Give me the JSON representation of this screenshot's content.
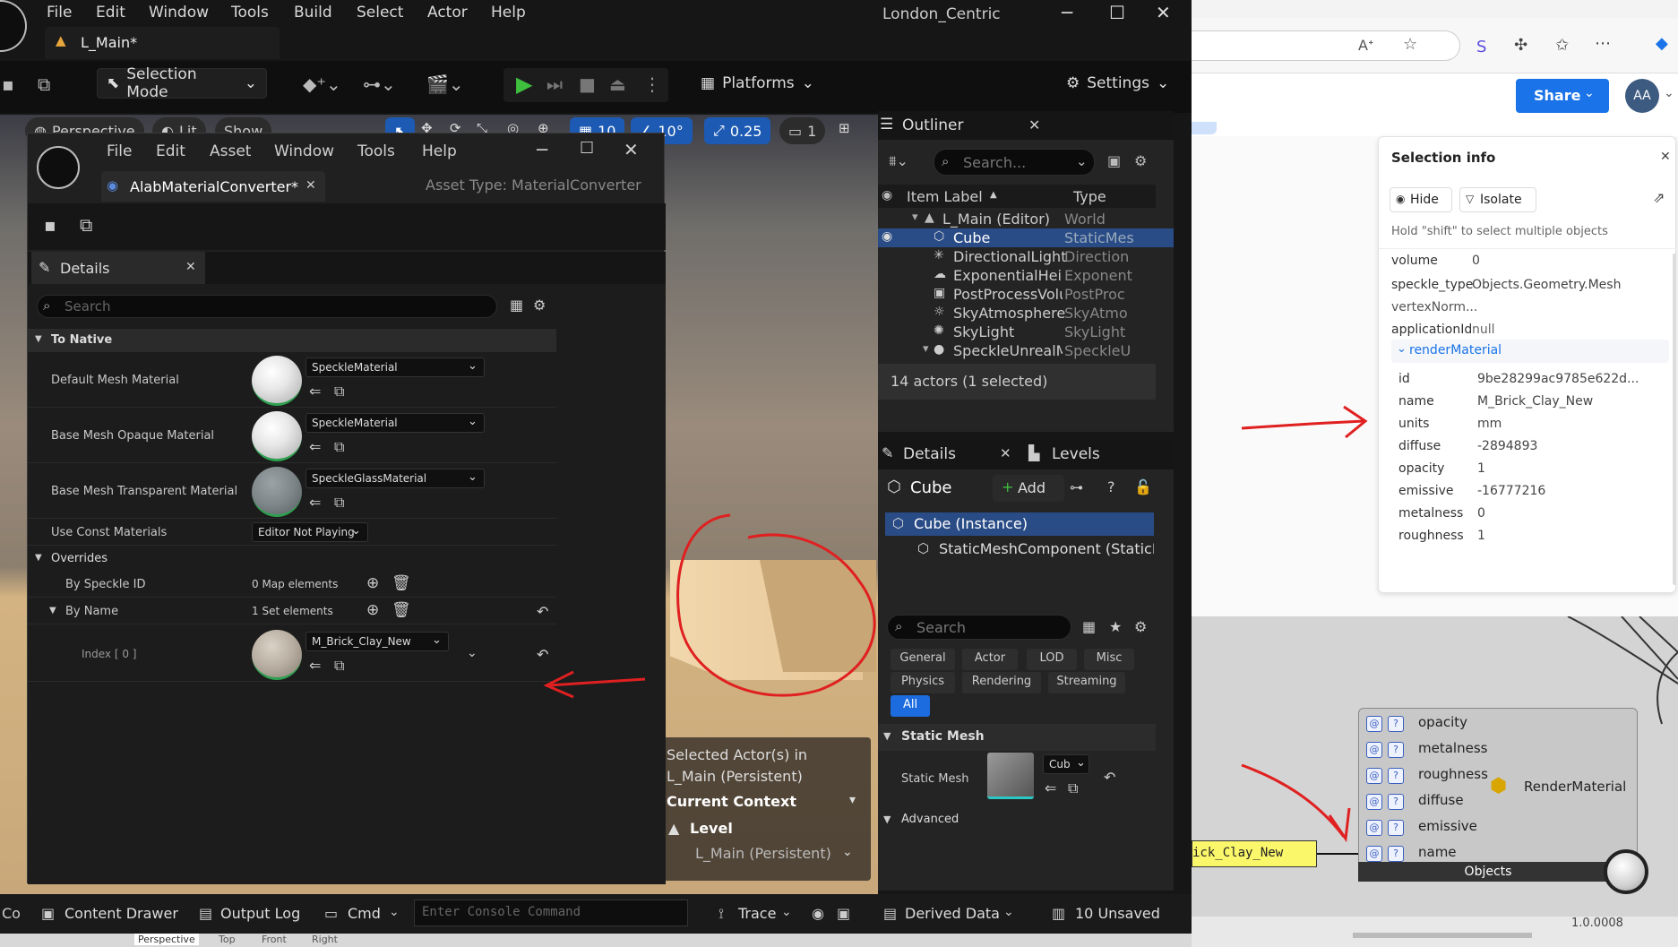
{
  "main_window": {
    "menu": [
      "File",
      "Edit",
      "Window",
      "Tools",
      "Build",
      "Select",
      "Actor",
      "Help"
    ],
    "project_title": "London_Centric",
    "tab": "L_Main*",
    "toolbar": {
      "selection_mode": "Selection Mode",
      "platforms": "Platforms",
      "settings": "Settings"
    },
    "viewport": {
      "perspective": "Perspective",
      "lit": "Lit",
      "show": "Show",
      "grid_value": "10",
      "angle_value": "10°",
      "scale_value": "0.25",
      "camera_value": "1",
      "bottom_tabs": [
        "Perspective",
        "Top",
        "Front",
        "Right"
      ]
    },
    "statusbar": {
      "content_drawer": "Content Drawer",
      "output_log": "Output Log",
      "cmd": "Cmd",
      "console_placeholder": "Enter Console Command",
      "trace": "Trace",
      "derived_data": "Derived Data",
      "unsaved": "10 Unsaved"
    }
  },
  "outliner": {
    "title": "Outliner",
    "search_placeholder": "Search...",
    "col_label": "Item Label",
    "col_type": "Type",
    "rows": [
      {
        "label": "L_Main (Editor)",
        "type": "World"
      },
      {
        "label": "Cube",
        "type": "StaticMes"
      },
      {
        "label": "DirectionalLight",
        "type": "Direction"
      },
      {
        "label": "ExponentialHeigh",
        "type": "Exponent"
      },
      {
        "label": "PostProcessVolu",
        "type": "PostProc"
      },
      {
        "label": "SkyAtmosphere",
        "type": "SkyAtmo"
      },
      {
        "label": "SkyLight",
        "type": "SkyLight"
      },
      {
        "label": "SpeckleUnrealMai",
        "type": "SpeckleU"
      }
    ],
    "footer": "14 actors (1 selected)"
  },
  "details_main": {
    "tab_details": "Details",
    "tab_levels": "Levels",
    "actor_name": "Cube",
    "add": "Add",
    "instance": "Cube (Instance)",
    "component": "StaticMeshComponent (StaticMe",
    "search_placeholder": "Search",
    "filters": [
      "General",
      "Actor",
      "LOD",
      "Misc",
      "Physics",
      "Rendering",
      "Streaming",
      "All"
    ],
    "section_static_mesh": "Static Mesh",
    "prop_static_mesh": "Static Mesh",
    "static_mesh_value": "Cub",
    "section_advanced": "Advanced"
  },
  "context_panel": {
    "line1": "Selected Actor(s) in",
    "line2": "L_Main (Persistent)",
    "current_context": "Current Context",
    "level": "Level",
    "level_value": "L_Main (Persistent)"
  },
  "alab": {
    "menu": [
      "File",
      "Edit",
      "Asset",
      "Window",
      "Tools",
      "Help"
    ],
    "tab": "AlabMaterialConverter*",
    "asset_type": "Asset Type: MaterialConverter",
    "details_title": "Details",
    "search_placeholder": "Search",
    "section_native": "To Native",
    "props": [
      {
        "label": "Default Mesh Material",
        "value": "SpeckleMaterial"
      },
      {
        "label": "Base Mesh Opaque Material",
        "value": "SpeckleMaterial"
      },
      {
        "label": "Base Mesh Transparent Material",
        "value": "SpeckleGlassMaterial"
      }
    ],
    "use_const_label": "Use Const Materials",
    "use_const_value": "Editor Not Playing",
    "section_overrides": "Overrides",
    "by_id_label": "By Speckle ID",
    "by_id_value": "0 Map elements",
    "by_name_label": "By Name",
    "by_name_value": "1 Set elements",
    "index_label": "Index [ 0 ]",
    "index_value": "M_Brick_Clay_New"
  },
  "browser": {
    "share": "Share",
    "avatar": "AA",
    "selection_info": {
      "title": "Selection info",
      "hide": "Hide",
      "isolate": "Isolate",
      "hint": "Hold \"shift\" to select multiple objects",
      "top_rows": [
        {
          "k": "volume",
          "v": "0"
        },
        {
          "k": "speckle_type",
          "v": "Objects.Geometry.Mesh"
        },
        {
          "k": "vertexNorm...",
          "v": ""
        },
        {
          "k": "applicationId",
          "v": "null"
        }
      ],
      "group": "renderMaterial",
      "group_rows": [
        {
          "k": "id",
          "v": "9be28299ac9785e622d..."
        },
        {
          "k": "name",
          "v": "M_Brick_Clay_New"
        },
        {
          "k": "units",
          "v": "mm"
        },
        {
          "k": "diffuse",
          "v": "-2894893"
        },
        {
          "k": "opacity",
          "v": "1"
        },
        {
          "k": "emissive",
          "v": "-16777216"
        },
        {
          "k": "metalness",
          "v": "0"
        },
        {
          "k": "roughness",
          "v": "1"
        }
      ]
    },
    "gh": {
      "panel_text": "ick_Clay_New",
      "ports": [
        "opacity",
        "metalness",
        "roughness",
        "diffuse",
        "emissive",
        "name"
      ],
      "component": "RenderMaterial",
      "footer": "Objects",
      "version": "1.0.0008"
    }
  },
  "colors": {
    "annotation": "#e02020",
    "accent": "#1c5ab3",
    "share": "#1a73e8"
  }
}
